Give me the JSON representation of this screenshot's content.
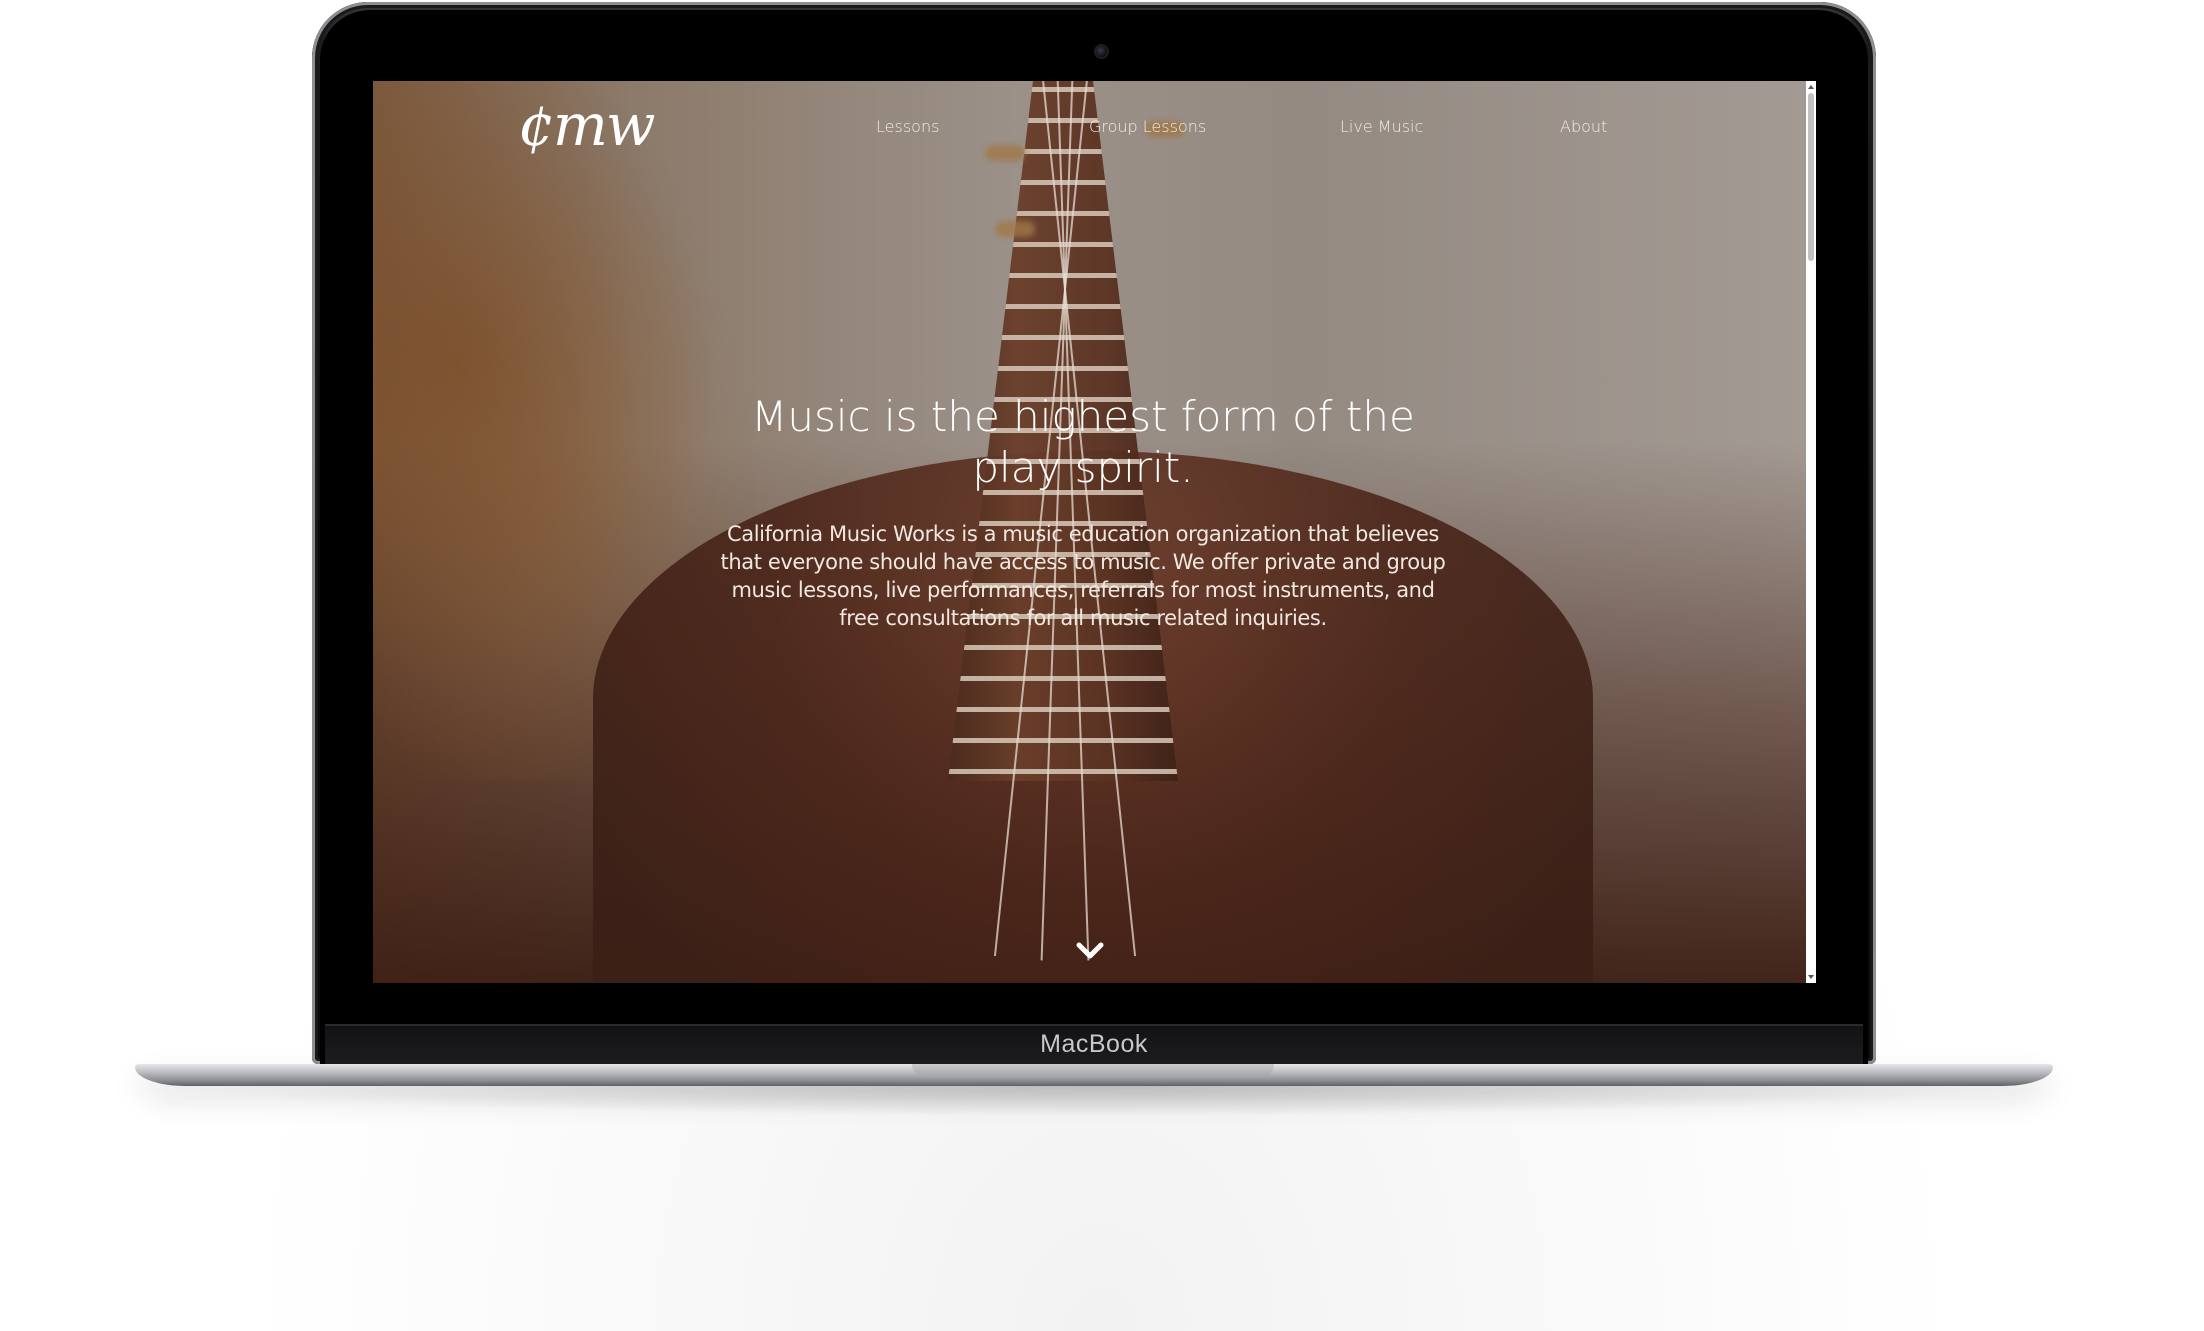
{
  "device": {
    "brand_label": "MacBook"
  },
  "site": {
    "logo_text": "¢mw",
    "nav": [
      {
        "label": "Lessons"
      },
      {
        "label": "Group Lessons"
      },
      {
        "label": "Live Music"
      },
      {
        "label": "About"
      }
    ],
    "hero": {
      "headline": "Music is the highest form of the play spirit.",
      "description": "California Music Works is a music education organization that believes that everyone should have access to music. We offer private and group music lessons, live performances, referrals for most instruments, and free consultations for all music related inquiries.",
      "scroll_icon": "chevron-down-icon"
    }
  },
  "colors": {
    "hero_dark": "#3b1f16",
    "text": "#ffffff",
    "scrollbar_track": "#ffffff",
    "scrollbar_thumb": "#c1c1c1"
  },
  "scrollbar": {
    "position_fraction": 0.0
  }
}
